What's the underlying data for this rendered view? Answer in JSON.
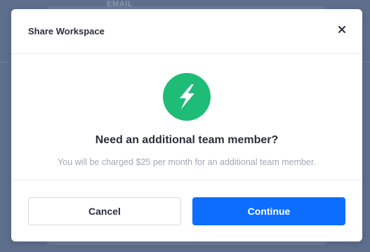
{
  "backdrop": {
    "field_label": "EMAIL"
  },
  "modal": {
    "title": "Share Workspace",
    "close_icon": "close-icon",
    "feature_icon": "lightning-bolt-icon",
    "heading": "Need an additional team member?",
    "description": "You will be charged $25 per month for an additional team member.",
    "cancel_label": "Cancel",
    "continue_label": "Continue"
  },
  "colors": {
    "accent": "#0d6efd",
    "success_icon_bg": "#1ebc76",
    "overlay": "#5d6f8c"
  }
}
